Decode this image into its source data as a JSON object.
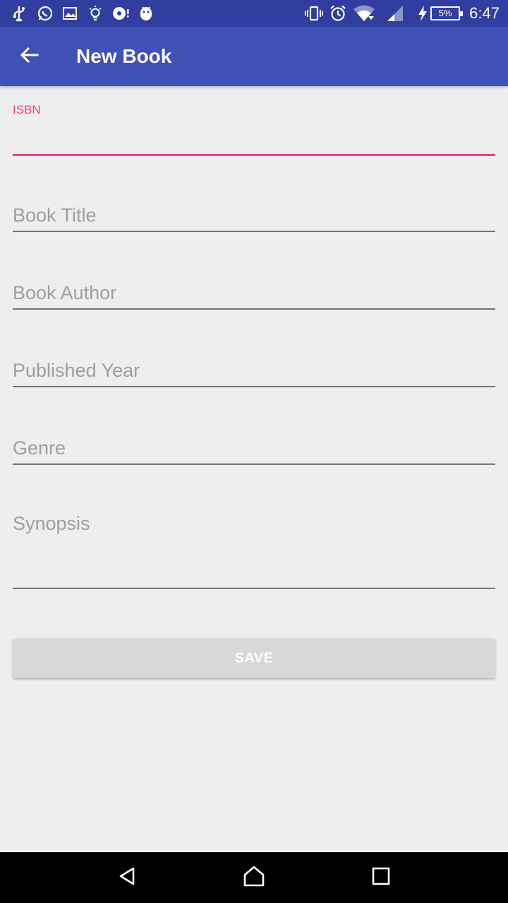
{
  "status_bar": {
    "time": "6:47",
    "battery": "5%",
    "icons_left": [
      "usb-icon",
      "whatsapp-icon",
      "image-icon",
      "lightbulb-icon",
      "music-icon",
      "android-icon"
    ],
    "icons_right": [
      "vibrate-icon",
      "alarm-icon",
      "wifi-icon",
      "signal-icon",
      "charging-icon"
    ]
  },
  "app_bar": {
    "title": "New Book"
  },
  "form": {
    "isbn_label": "ISBN",
    "isbn_value": "",
    "title_hint": "Book Title",
    "author_hint": "Book Author",
    "year_hint": "Published Year",
    "genre_hint": "Genre",
    "synopsis_hint": "Synopsis"
  },
  "save_label": "SAVE",
  "colors": {
    "primary": "#3f51b5",
    "primary_dark": "#303f9f",
    "accent": "#ec407a",
    "background": "#eeeeee"
  }
}
